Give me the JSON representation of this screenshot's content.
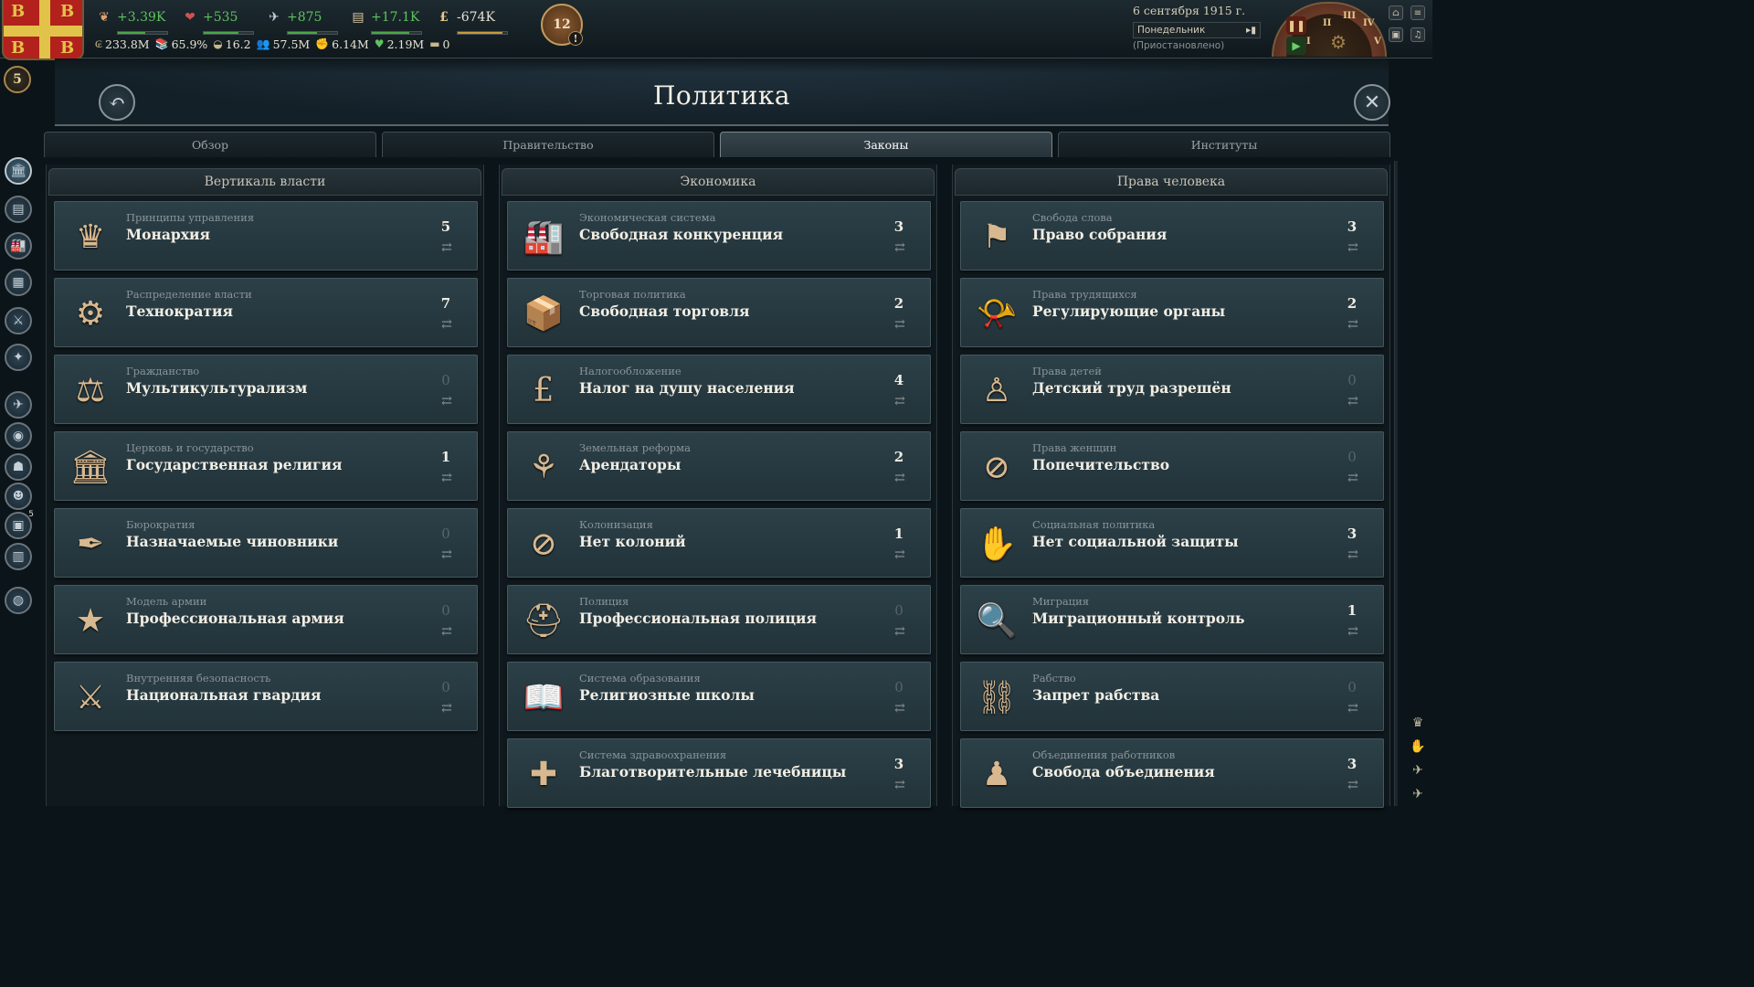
{
  "topbar": {
    "resources": [
      {
        "icon": "authority-icon",
        "value": "+3.39K",
        "bar": 0.55
      },
      {
        "icon": "influence-icon",
        "value": "+535",
        "bar": 0.7
      },
      {
        "icon": "bureaucracy-icon",
        "value": "+875",
        "bar": 0.6
      },
      {
        "icon": "weekly-income-icon",
        "value": "+17.1K",
        "bar": 0.75
      },
      {
        "icon": "treasury-icon",
        "value": "-674K",
        "bar": 0.9
      }
    ],
    "stats": [
      {
        "icon": "gdp-icon",
        "value": "233.8M"
      },
      {
        "icon": "literacy-icon",
        "value": "65.9%"
      },
      {
        "icon": "sol-icon",
        "value": "16.2"
      },
      {
        "icon": "population-icon",
        "value": "57.5M"
      },
      {
        "icon": "radicals-icon",
        "value": "6.14M"
      },
      {
        "icon": "loyalists-icon",
        "value": "2.19M"
      },
      {
        "icon": "infamy-icon",
        "value": "0"
      }
    ],
    "alert_count": "12",
    "rank": "5",
    "date": "6 сентября 1915 г.",
    "weekday": "Понедельник",
    "status": "(Приостановлено)",
    "speed_labels": [
      "I",
      "II",
      "III",
      "IV",
      "V"
    ]
  },
  "header": {
    "title": "Политика"
  },
  "tabs": [
    {
      "label": "Обзор",
      "active": false
    },
    {
      "label": "Правительство",
      "active": false
    },
    {
      "label": "Законы",
      "active": true
    },
    {
      "label": "Институты",
      "active": false
    }
  ],
  "sidebar": [
    {
      "icon": "politics-icon",
      "active": true
    },
    {
      "icon": "budget-icon"
    },
    {
      "icon": "industry-icon"
    },
    {
      "icon": "market-icon"
    },
    {
      "icon": "military-icon"
    },
    {
      "icon": "diplomacy-icon"
    },
    {
      "icon": "society-icon"
    },
    {
      "icon": "population-icon"
    },
    {
      "icon": "culture-icon"
    },
    {
      "icon": "interest-groups-icon"
    },
    {
      "icon": "journal-icon",
      "badge": "5"
    },
    {
      "icon": "events-icon"
    },
    {
      "icon": "outliner-icon"
    }
  ],
  "columns": [
    {
      "title": "Вертикаль власти",
      "laws": [
        {
          "category": "Принципы управления",
          "name": "Монархия",
          "count": "5",
          "icon": "crown-icon",
          "glyph": "♛"
        },
        {
          "category": "Распределение власти",
          "name": "Технократия",
          "count": "7",
          "icon": "gear-icon",
          "glyph": "⚙"
        },
        {
          "category": "Гражданство",
          "name": "Мультикультурализм",
          "count": "0",
          "icon": "scales-icon",
          "glyph": "⚖"
        },
        {
          "category": "Церковь и государство",
          "name": "Государственная религия",
          "count": "1",
          "icon": "temple-icon",
          "glyph": "🏛"
        },
        {
          "category": "Бюрократия",
          "name": "Назначаемые чиновники",
          "count": "0",
          "icon": "quill-icon",
          "glyph": "✒"
        },
        {
          "category": "Модель армии",
          "name": "Профессиональная армия",
          "count": "0",
          "icon": "star-medal-icon",
          "glyph": "★"
        },
        {
          "category": "Внутренняя безопасность",
          "name": "Национальная гвардия",
          "count": "0",
          "icon": "soldiers-icon",
          "glyph": "⚔"
        }
      ]
    },
    {
      "title": "Экономика",
      "laws": [
        {
          "category": "Экономическая система",
          "name": "Свободная конкуренция",
          "count": "3",
          "icon": "factory-icon",
          "glyph": "🏭"
        },
        {
          "category": "Торговая политика",
          "name": "Свободная торговля",
          "count": "2",
          "icon": "crate-icon",
          "glyph": "📦"
        },
        {
          "category": "Налогообложение",
          "name": "Налог на душу населения",
          "count": "4",
          "icon": "money-bag-icon",
          "glyph": "£"
        },
        {
          "category": "Земельная реформа",
          "name": "Арендаторы",
          "count": "2",
          "icon": "wheat-icon",
          "glyph": "⚘"
        },
        {
          "category": "Колонизация",
          "name": "Нет колоний",
          "count": "1",
          "icon": "no-colony-icon",
          "glyph": "⊘"
        },
        {
          "category": "Полиция",
          "name": "Профессиональная полиция",
          "count": "0",
          "icon": "police-helmet-icon",
          "glyph": "⛑"
        },
        {
          "category": "Система образования",
          "name": "Религиозные школы",
          "count": "0",
          "icon": "book-icon",
          "glyph": "📖"
        },
        {
          "category": "Система здравоохранения",
          "name": "Благотворительные лечебницы",
          "count": "3",
          "icon": "medicine-icon",
          "glyph": "✚"
        }
      ]
    },
    {
      "title": "Права человека",
      "laws": [
        {
          "category": "Свобода слова",
          "name": "Право собрания",
          "count": "3",
          "icon": "placards-icon",
          "glyph": "⚑"
        },
        {
          "category": "Права трудящихся",
          "name": "Регулирующие органы",
          "count": "2",
          "icon": "whistle-icon",
          "glyph": "📯"
        },
        {
          "category": "Права детей",
          "name": "Детский труд разрешён",
          "count": "0",
          "icon": "child-icon",
          "glyph": "♙"
        },
        {
          "category": "Права женщин",
          "name": "Попечительство",
          "count": "0",
          "icon": "no-women-icon",
          "glyph": "⊘"
        },
        {
          "category": "Социальная политика",
          "name": "Нет социальной защиты",
          "count": "3",
          "icon": "hands-icon",
          "glyph": "✋"
        },
        {
          "category": "Миграция",
          "name": "Миграционный контроль",
          "count": "1",
          "icon": "inspector-icon",
          "glyph": "🔍"
        },
        {
          "category": "Рабство",
          "name": "Запрет рабства",
          "count": "0",
          "icon": "broken-chain-icon",
          "glyph": "⛓"
        },
        {
          "category": "Объединения работников",
          "name": "Свобода объединения",
          "count": "3",
          "icon": "workers-icon",
          "glyph": "♟"
        }
      ]
    }
  ],
  "colors": {
    "positive": "#5ec25e",
    "panel": "#2c4048",
    "accent": "#d8b890"
  }
}
